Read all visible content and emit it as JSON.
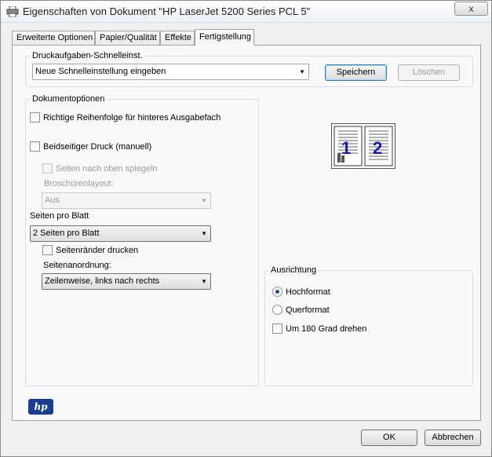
{
  "window": {
    "title": "Eigenschaften von Dokument \"HP LaserJet 5200 Series PCL 5\"",
    "close_label": "x"
  },
  "tabs": [
    {
      "label": "Erweiterte Optionen"
    },
    {
      "label": "Papier/Qualität"
    },
    {
      "label": "Effekte"
    },
    {
      "label": "Fertigstellung",
      "active": true
    }
  ],
  "quickset": {
    "group_label": "Druckaufgaben-Schnelleinst.",
    "value": "Neue Schnelleinstellung eingeben",
    "save_label": "Speichern",
    "delete_label": "Löschen"
  },
  "document_options": {
    "group_label": "Dokumentoptionen",
    "reverse_order": {
      "label": "Richtige Reihenfolge für hinteres Ausgabefach",
      "checked": false
    },
    "duplex": {
      "label": "Beidseitiger Druck (manuell)",
      "checked": false
    },
    "flip_pages": {
      "label": "Seiten nach oben spiegeln",
      "checked": false,
      "disabled": true
    },
    "booklet_label": "Broschürenlayout:",
    "booklet_value": "Aus",
    "pages_per_sheet_label": "Seiten pro Blatt",
    "pages_per_sheet_value": "2 Seiten pro Blatt",
    "print_borders": {
      "label": "Seitenränder drucken",
      "checked": false
    },
    "page_order_label": "Seitenanordnung:",
    "page_order_value": "Zeilenweise, links nach rechts"
  },
  "preview": {
    "page_numbers": [
      "1",
      "2"
    ],
    "accent_color": "#1a1aa6"
  },
  "orientation": {
    "group_label": "Ausrichtung",
    "portrait": {
      "label": "Hochformat",
      "selected": true
    },
    "landscape": {
      "label": "Querformat",
      "selected": false
    },
    "rotate": {
      "label": "Um 180 Grad drehen",
      "checked": false
    }
  },
  "logo": {
    "text": "hp",
    "color": "#1c3d8c"
  },
  "footer": {
    "ok_label": "OK",
    "cancel_label": "Abbrechen"
  }
}
